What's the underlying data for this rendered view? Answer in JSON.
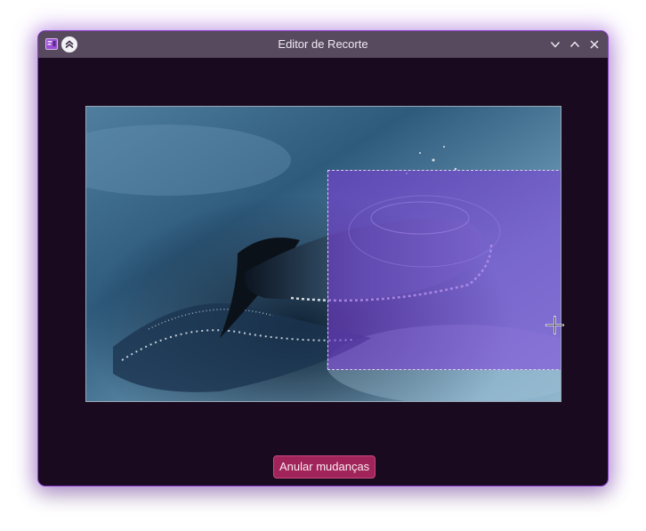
{
  "window": {
    "title": "Editor de Recorte",
    "accent": "#8a3fd1",
    "titlebar_bg": "#574a5f",
    "background": "#190a1f"
  },
  "titlebar": {
    "left_icons": [
      "app-icon",
      "keep-above-icon"
    ],
    "controls": [
      "minimize-icon",
      "maximize-icon",
      "close-icon"
    ]
  },
  "editor": {
    "image_description_icon": "dolphin-photo",
    "crop_overlay_color": "#803adc"
  },
  "actions": {
    "undo_label": "Anular mudanças",
    "undo_color": "#a0245a"
  }
}
